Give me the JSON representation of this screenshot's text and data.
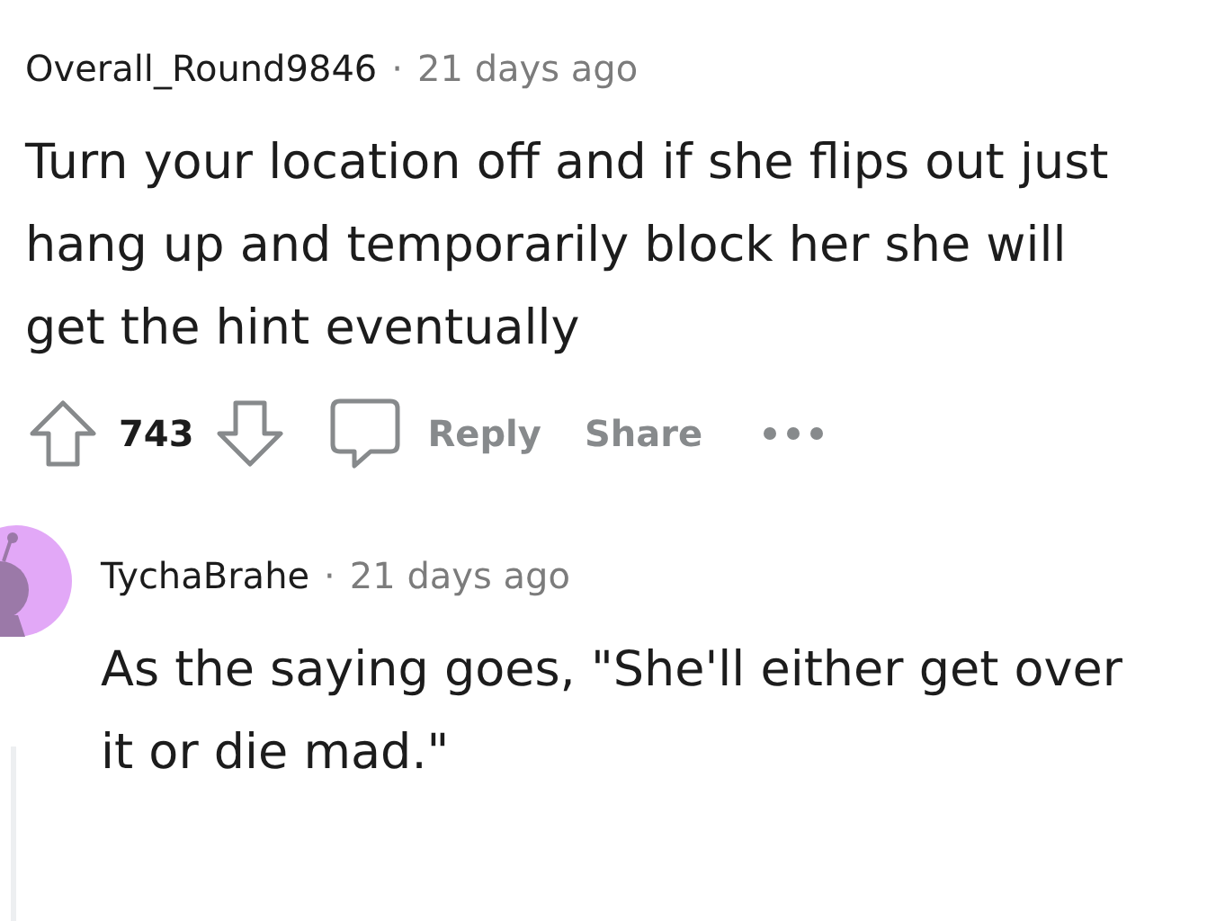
{
  "comments": [
    {
      "author": "Overall_Round9846",
      "separator": "·",
      "time": "21 days ago",
      "avatar": false,
      "body": "Turn your location off and if she flips out just hang up and temporarily block her she will get the hint eventually",
      "votes": "743",
      "actions": [
        "Reply",
        "Share"
      ]
    },
    {
      "author": "TychaBrahe",
      "separator": "·",
      "time": "21 days ago",
      "avatar": true,
      "body": "As the saying goes, \"She'll either get over it or die mad.\""
    }
  ]
}
